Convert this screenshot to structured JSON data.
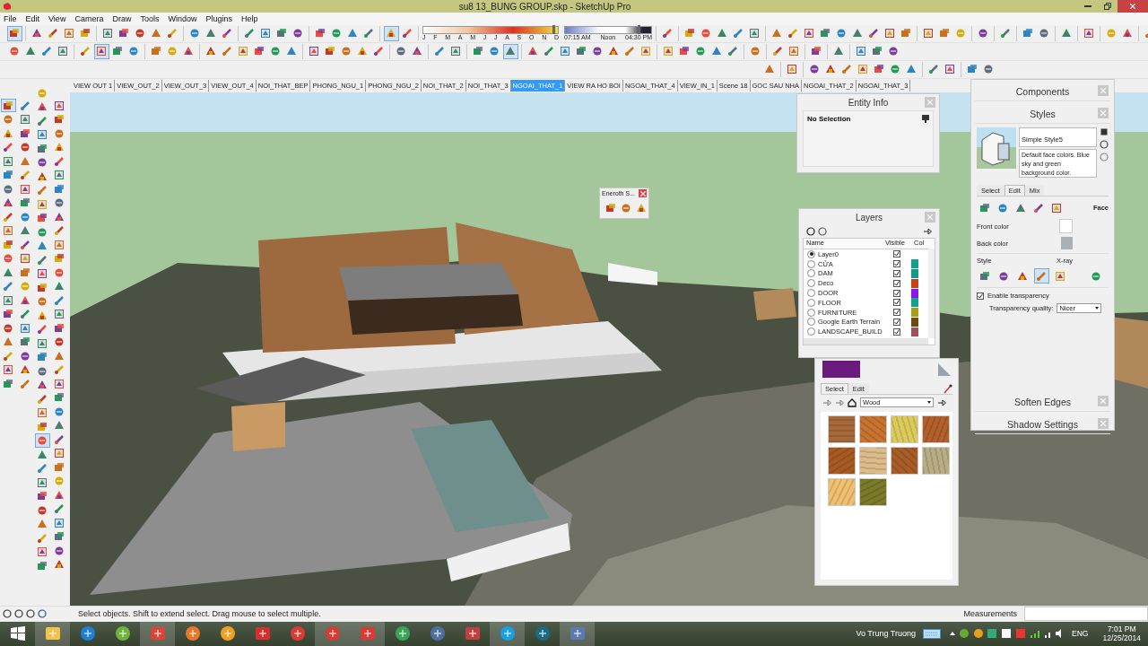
{
  "window": {
    "title": "su8 13_BUNG GROUP.skp - SketchUp Pro"
  },
  "menu": [
    "File",
    "Edit",
    "View",
    "Camera",
    "Draw",
    "Tools",
    "Window",
    "Plugins",
    "Help"
  ],
  "toolbar_rows": [
    {
      "left_groups": [
        [
          true
        ],
        [
          false,
          false,
          false,
          false
        ],
        [
          false,
          false,
          false,
          false,
          false
        ],
        [
          false,
          false,
          false
        ],
        [
          false,
          false,
          false,
          false
        ],
        [
          false,
          false,
          false,
          false
        ],
        [
          true,
          false
        ]
      ],
      "right_groups": [
        [
          false
        ],
        [
          false,
          false,
          false,
          false,
          false
        ],
        [
          false,
          false,
          false,
          false,
          false,
          false,
          false,
          false,
          false
        ],
        [
          false,
          false,
          false
        ],
        [
          false
        ],
        [
          false
        ],
        [
          false,
          false
        ],
        [
          false
        ],
        [
          false
        ],
        [
          false,
          false
        ],
        [
          false
        ]
      ]
    },
    {
      "left_groups": [
        [
          false,
          false,
          false,
          false
        ],
        [
          false,
          true,
          false,
          false
        ],
        [
          false,
          false,
          false
        ],
        [
          false,
          false,
          false,
          false,
          false,
          false
        ],
        [
          false,
          false,
          false,
          false,
          false
        ],
        [
          false,
          false
        ],
        [
          false,
          false
        ],
        [
          false,
          false,
          true
        ],
        [
          false,
          false,
          false,
          false,
          false,
          false,
          false,
          false
        ],
        [
          false,
          false,
          false,
          false,
          false
        ],
        [
          false
        ],
        [
          false,
          false
        ],
        [
          false
        ],
        [
          false
        ],
        [
          false,
          false,
          false
        ]
      ],
      "right_groups": []
    },
    {
      "left_groups": [
        [
          false
        ],
        [
          false
        ],
        [
          false,
          false,
          false,
          false,
          false,
          false,
          false
        ],
        [
          false,
          false
        ],
        [
          false,
          false
        ]
      ],
      "right_groups": []
    }
  ],
  "shadow_timeline": {
    "months": [
      "J",
      "F",
      "M",
      "A",
      "M",
      "J",
      "J",
      "A",
      "S",
      "O",
      "N",
      "D"
    ],
    "times": [
      "07:15 AM",
      "Noon",
      "04:30 PM"
    ],
    "date": {
      "level": 0.97
    },
    "time": {
      "level": 0.86
    }
  },
  "left_toolbar": [
    [
      true,
      false,
      false,
      false,
      false,
      false,
      false,
      false,
      false,
      false,
      false,
      false,
      false,
      false,
      false,
      false,
      false,
      false,
      false,
      false,
      false
    ],
    [
      false,
      false,
      false,
      false,
      false,
      false,
      false,
      false,
      false,
      false,
      false,
      false,
      false,
      false,
      false,
      false,
      false,
      false,
      false,
      false,
      false
    ],
    [
      false,
      false,
      false,
      false,
      false,
      false,
      false,
      false,
      false,
      false,
      false,
      false,
      false,
      false,
      false,
      false,
      false,
      false,
      false,
      false,
      false,
      false,
      false,
      false,
      false,
      true,
      false,
      false,
      false,
      false,
      false,
      false,
      false,
      false,
      false
    ],
    [
      false,
      false,
      false,
      false,
      false,
      false,
      false,
      false,
      false,
      false,
      false,
      false,
      false,
      false,
      false,
      false,
      false,
      false,
      false,
      false,
      false,
      false,
      false,
      false,
      false,
      false,
      false,
      false,
      false,
      false,
      false,
      false,
      false,
      false
    ]
  ],
  "scene_tabs": [
    {
      "label": "VIEW OUT 1",
      "selected": false
    },
    {
      "label": "VIEW_OUT_2",
      "selected": false
    },
    {
      "label": "VIEW_OUT_3",
      "selected": false
    },
    {
      "label": "VIEW_OUT_4",
      "selected": false
    },
    {
      "label": "NOI_THAT_BEP",
      "selected": false
    },
    {
      "label": "PHONG_NGU_1",
      "selected": false
    },
    {
      "label": "PHONG_NGU_2",
      "selected": false
    },
    {
      "label": "NOI_THAT_2",
      "selected": false
    },
    {
      "label": "NOI_THAT_3",
      "selected": false
    },
    {
      "label": "NGOAI_THAT_1",
      "selected": true
    },
    {
      "label": "VIEW RA HO BOI",
      "selected": false
    },
    {
      "label": "NGOAI_THAT_4",
      "selected": false
    },
    {
      "label": "VIEW_IN_1",
      "selected": false
    },
    {
      "label": "Scene 18",
      "selected": false
    },
    {
      "label": "GOC SAU NHA",
      "selected": false
    },
    {
      "label": "NGOAI_THAT_2",
      "selected": false
    },
    {
      "label": "NGOAI_THAT_3",
      "selected": false
    }
  ],
  "entity_info": {
    "title": "Entity Info",
    "selection": "No Selection"
  },
  "eneroth_window": {
    "title": "Eneroth S..."
  },
  "layers": {
    "title": "Layers",
    "columns": [
      "Name",
      "Visible",
      "Col"
    ],
    "rows": [
      {
        "name": "Layer0",
        "selected": true,
        "visible": true
      },
      {
        "name": "CỬA",
        "selected": false,
        "visible": true,
        "color": "#13a08c"
      },
      {
        "name": "DAM",
        "selected": false,
        "visible": true,
        "color": "#12998a"
      },
      {
        "name": "Deco",
        "selected": false,
        "visible": true,
        "color": "#c4441a"
      },
      {
        "name": "DOOR",
        "selected": false,
        "visible": true,
        "color": "#8c14e6"
      },
      {
        "name": "FLOOR",
        "selected": false,
        "visible": true,
        "color": "#13a08c"
      },
      {
        "name": "FURNITURE",
        "selected": false,
        "visible": true,
        "color": "#a3a01e"
      },
      {
        "name": "Google Earth Terrain",
        "selected": false,
        "visible": true,
        "color": "#6e4810"
      },
      {
        "name": "LANDSCAPE_BUILD",
        "selected": false,
        "visible": true,
        "color": "#a0505e"
      }
    ]
  },
  "materials": {
    "tabs": [
      {
        "label": "Select",
        "selected": true
      },
      {
        "label": "Edit",
        "selected": false
      }
    ],
    "collection": "Wood",
    "swatches": [
      {
        "color": "#a8693a"
      },
      {
        "color": "#c8742e"
      },
      {
        "color": "#dccb5a"
      },
      {
        "color": "#b3602a"
      },
      {
        "color": "#a85a22"
      },
      {
        "color": "#dcbc8a"
      },
      {
        "color": "#a85c28"
      },
      {
        "color": "#b8ac84"
      },
      {
        "color": "#f0c070"
      },
      {
        "color": "#7a7a28"
      }
    ]
  },
  "tray": {
    "panels": [
      {
        "kind": "collapsed",
        "title": "Components"
      },
      {
        "kind": "styles",
        "title": "Styles",
        "style_name": "Simple Style5",
        "description": "Default face colors. Blue sky and green background color.",
        "tabs": [
          {
            "label": "Select",
            "selected": false
          },
          {
            "label": "Edit",
            "selected": true
          },
          {
            "label": "Mix",
            "selected": false
          }
        ],
        "section": "Face",
        "front_color_label": "Front color",
        "back_color_label": "Back color",
        "style_label": "Style",
        "xray_label": "X-ray",
        "transparency": {
          "label": "Enable transparency",
          "checked": true
        },
        "quality_label": "Transparency quality:",
        "quality": "Nicer"
      },
      {
        "kind": "collapsed",
        "title": "Soften Edges"
      },
      {
        "kind": "collapsed",
        "title": "Shadow Settings"
      }
    ]
  },
  "status_bar": {
    "message": "Select objects. Shift to extend select. Drag mouse to select multiple.",
    "measurements_label": "Measurements"
  },
  "taskbar": {
    "user": "Vo Trung Truong",
    "language": "ENG",
    "time": "7:01 PM",
    "date": "12/25/2014"
  }
}
